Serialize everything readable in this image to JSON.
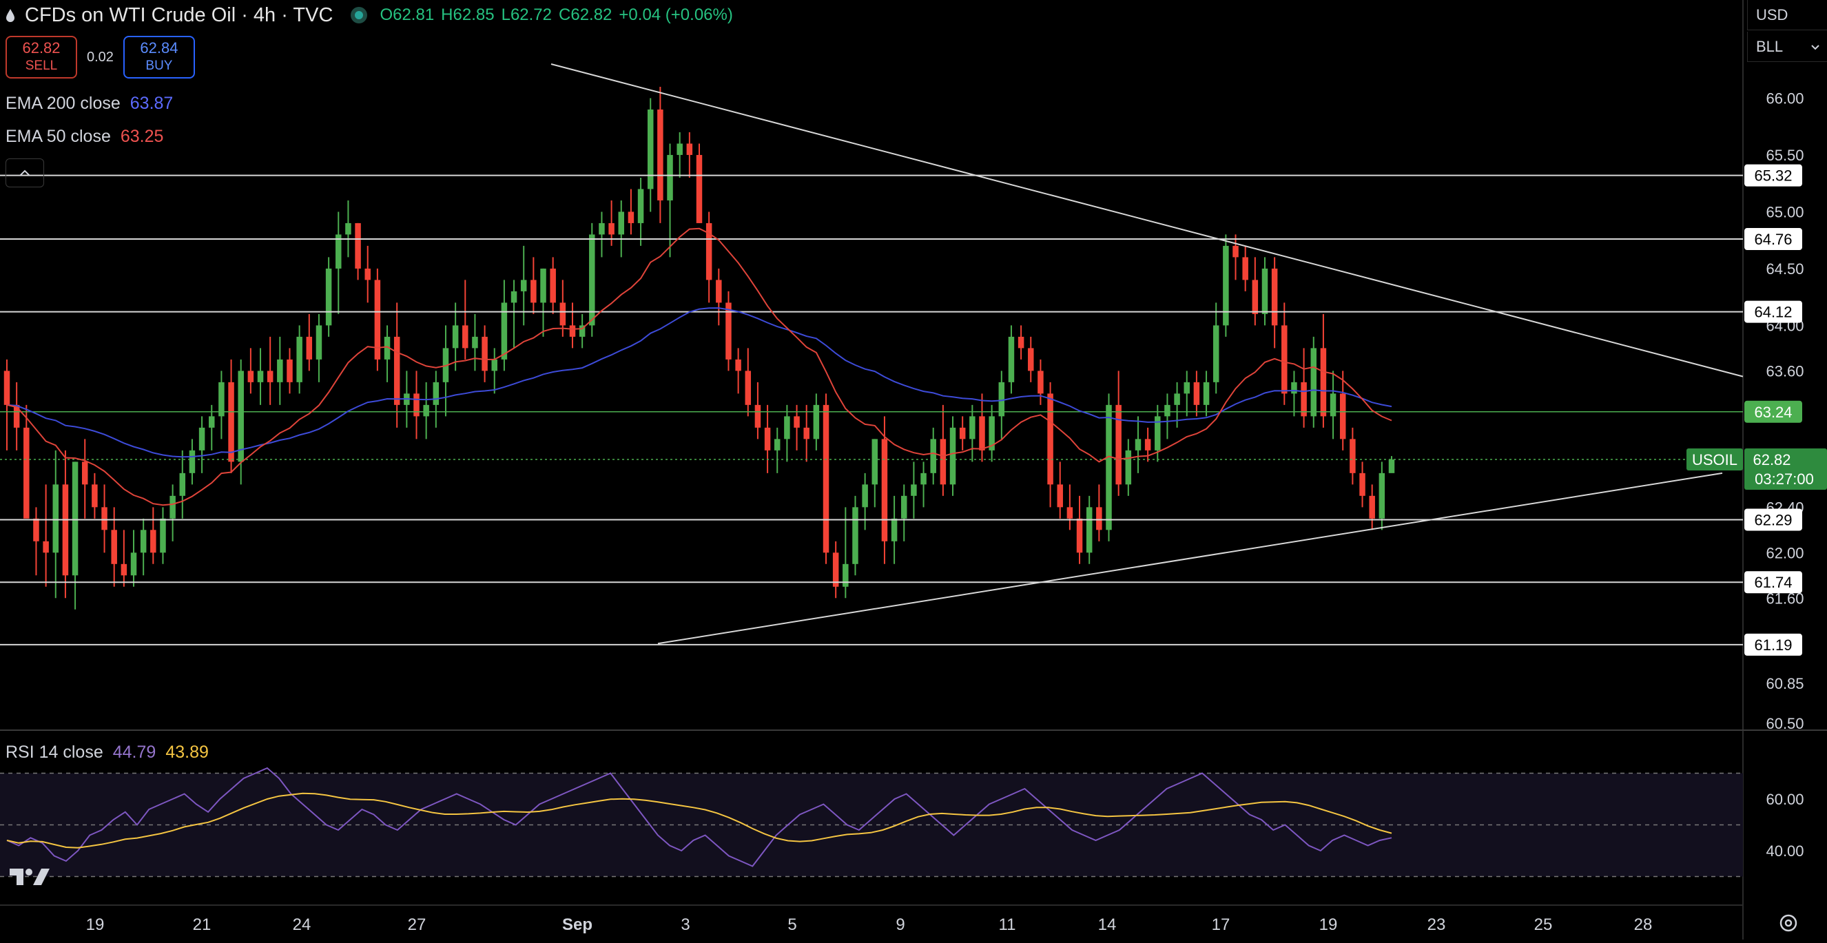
{
  "header": {
    "title": "CFDs on WTI Crude Oil · 4h · TVC",
    "ohlc": {
      "o_label": "O",
      "o": "62.81",
      "h_label": "H",
      "h": "62.85",
      "l_label": "L",
      "l": "62.72",
      "c_label": "C",
      "c": "62.82",
      "change": "+0.04 (+0.06%)"
    }
  },
  "trade": {
    "sell_price": "62.82",
    "sell_label": "SELL",
    "spread": "0.02",
    "buy_price": "62.84",
    "buy_label": "BUY"
  },
  "indicators": {
    "ema200_label": "EMA 200 close",
    "ema200_value": "63.87",
    "ema50_label": "EMA 50 close",
    "ema50_value": "63.25",
    "rsi_label": "RSI 14 close",
    "rsi_value": "44.79",
    "rsi_ma_value": "43.89"
  },
  "selectors": {
    "currency": "USD",
    "unit": "BLL"
  },
  "symbol": {
    "tag": "USOIL",
    "price": "62.82",
    "countdown": "03:27:00"
  },
  "colors": {
    "bg": "#000000",
    "up": "#4caf50",
    "down": "#f44336",
    "ema200": "#3d4bd8",
    "ema50": "#e0443a",
    "rsi": "#7e57c2",
    "rsi_ma": "#f5c542",
    "green_level": "#4caf50",
    "line": "#d8d8d8"
  },
  "chart_data": {
    "type": "candlestick",
    "timeframe": "4h",
    "x_tick_labels": [
      "19",
      "21",
      "24",
      "27",
      "Sep",
      "3",
      "5",
      "9",
      "11",
      "14",
      "17",
      "19",
      "23",
      "25",
      "28"
    ],
    "y_tick_labels": [
      "66.00",
      "65.50",
      "65.00",
      "64.50",
      "64.00",
      "63.60",
      "62.40",
      "62.00",
      "61.60",
      "60.85",
      "60.50"
    ],
    "y_range": [
      60.45,
      66.5
    ],
    "horizontal_levels": [
      "65.32",
      "64.76",
      "64.12",
      "63.24",
      "62.29",
      "61.74",
      "61.19"
    ],
    "green_level": "63.24",
    "current_price": "62.82",
    "trendlines": [
      {
        "name": "descending-resistance",
        "from": {
          "x": "Aug 29",
          "y": 66.3
        },
        "to": {
          "x": "Sep 23",
          "y": 63.55
        }
      },
      {
        "name": "ascending-support",
        "from": {
          "x": "Aug 30",
          "y": 61.2
        },
        "to": {
          "x": "Sep 22",
          "y": 62.7
        }
      }
    ],
    "ohlc_series": [
      [
        63.6,
        63.7,
        62.9,
        63.3
      ],
      [
        63.3,
        63.5,
        62.9,
        63.1
      ],
      [
        63.1,
        63.3,
        62.5,
        62.3
      ],
      [
        62.3,
        62.4,
        61.8,
        62.1
      ],
      [
        62.1,
        62.6,
        61.7,
        62.0
      ],
      [
        62.0,
        62.9,
        61.6,
        62.6
      ],
      [
        62.6,
        62.9,
        61.6,
        61.8
      ],
      [
        61.8,
        62.8,
        61.5,
        62.8
      ],
      [
        62.8,
        63.0,
        62.3,
        62.6
      ],
      [
        62.6,
        62.7,
        62.3,
        62.4
      ],
      [
        62.4,
        62.6,
        62.0,
        62.2
      ],
      [
        62.2,
        62.4,
        61.7,
        61.9
      ],
      [
        61.9,
        62.2,
        61.7,
        61.8
      ],
      [
        61.8,
        62.2,
        61.7,
        62.0
      ],
      [
        62.0,
        62.3,
        61.8,
        62.2
      ],
      [
        62.2,
        62.4,
        61.9,
        62.0
      ],
      [
        62.0,
        62.4,
        61.9,
        62.3
      ],
      [
        62.3,
        62.6,
        62.1,
        62.5
      ],
      [
        62.5,
        62.9,
        62.3,
        62.7
      ],
      [
        62.7,
        63.0,
        62.6,
        62.9
      ],
      [
        62.9,
        63.2,
        62.7,
        63.1
      ],
      [
        63.1,
        63.3,
        62.9,
        63.2
      ],
      [
        63.2,
        63.6,
        63.0,
        63.5
      ],
      [
        63.5,
        63.7,
        62.7,
        62.8
      ],
      [
        62.8,
        63.7,
        62.6,
        63.6
      ],
      [
        63.6,
        63.8,
        63.4,
        63.5
      ],
      [
        63.5,
        63.8,
        63.3,
        63.6
      ],
      [
        63.6,
        63.9,
        63.3,
        63.5
      ],
      [
        63.5,
        63.9,
        63.3,
        63.7
      ],
      [
        63.7,
        63.8,
        63.4,
        63.5
      ],
      [
        63.5,
        64.0,
        63.4,
        63.9
      ],
      [
        63.9,
        64.1,
        63.6,
        63.7
      ],
      [
        63.7,
        64.1,
        63.5,
        64.0
      ],
      [
        64.0,
        64.6,
        63.9,
        64.5
      ],
      [
        64.5,
        65.0,
        64.1,
        64.8
      ],
      [
        64.8,
        65.1,
        64.6,
        64.9
      ],
      [
        64.9,
        64.9,
        64.4,
        64.5
      ],
      [
        64.5,
        64.7,
        64.2,
        64.4
      ],
      [
        64.4,
        64.5,
        63.6,
        63.7
      ],
      [
        63.7,
        64.0,
        63.5,
        63.9
      ],
      [
        63.9,
        64.2,
        63.1,
        63.3
      ],
      [
        63.3,
        63.6,
        63.1,
        63.4
      ],
      [
        63.4,
        63.6,
        63.0,
        63.2
      ],
      [
        63.2,
        63.5,
        63.0,
        63.3
      ],
      [
        63.3,
        63.6,
        63.1,
        63.5
      ],
      [
        63.5,
        64.0,
        63.2,
        63.8
      ],
      [
        63.8,
        64.2,
        63.6,
        64.0
      ],
      [
        64.0,
        64.4,
        63.7,
        63.8
      ],
      [
        63.8,
        64.1,
        63.6,
        63.9
      ],
      [
        63.9,
        64.0,
        63.5,
        63.6
      ],
      [
        63.6,
        63.8,
        63.4,
        63.7
      ],
      [
        63.7,
        64.4,
        63.6,
        64.2
      ],
      [
        64.2,
        64.4,
        63.8,
        64.3
      ],
      [
        64.3,
        64.7,
        64.0,
        64.4
      ],
      [
        64.4,
        64.6,
        64.1,
        64.2
      ],
      [
        64.2,
        64.5,
        63.9,
        64.5
      ],
      [
        64.5,
        64.6,
        64.1,
        64.2
      ],
      [
        64.2,
        64.4,
        63.9,
        64.0
      ],
      [
        64.0,
        64.2,
        63.8,
        63.9
      ],
      [
        63.9,
        64.1,
        63.8,
        64.0
      ],
      [
        64.0,
        64.9,
        63.9,
        64.8
      ],
      [
        64.8,
        65.0,
        64.6,
        64.9
      ],
      [
        64.9,
        65.1,
        64.7,
        64.8
      ],
      [
        64.8,
        65.1,
        64.6,
        65.0
      ],
      [
        65.0,
        65.2,
        64.8,
        64.9
      ],
      [
        64.9,
        65.3,
        64.7,
        65.2
      ],
      [
        65.2,
        66.0,
        65.0,
        65.9
      ],
      [
        65.9,
        66.1,
        64.9,
        65.1
      ],
      [
        65.1,
        65.6,
        64.6,
        65.5
      ],
      [
        65.5,
        65.7,
        65.3,
        65.6
      ],
      [
        65.6,
        65.7,
        65.3,
        65.5
      ],
      [
        65.5,
        65.6,
        64.9,
        64.9
      ],
      [
        64.9,
        65.0,
        64.2,
        64.4
      ],
      [
        64.4,
        64.5,
        64.0,
        64.2
      ],
      [
        64.2,
        64.3,
        63.6,
        63.7
      ],
      [
        63.7,
        63.8,
        63.4,
        63.6
      ],
      [
        63.6,
        63.8,
        63.2,
        63.3
      ],
      [
        63.3,
        63.5,
        63.0,
        63.1
      ],
      [
        63.1,
        63.3,
        62.7,
        62.9
      ],
      [
        62.9,
        63.1,
        62.7,
        63.0
      ],
      [
        63.0,
        63.3,
        62.8,
        63.2
      ],
      [
        63.2,
        63.3,
        62.9,
        63.1
      ],
      [
        63.1,
        63.3,
        62.8,
        63.0
      ],
      [
        63.0,
        63.4,
        62.9,
        63.3
      ],
      [
        63.3,
        63.4,
        61.9,
        62.0
      ],
      [
        62.0,
        62.1,
        61.6,
        61.7
      ],
      [
        61.7,
        62.4,
        61.6,
        61.9
      ],
      [
        61.9,
        62.5,
        61.8,
        62.4
      ],
      [
        62.4,
        62.7,
        62.2,
        62.6
      ],
      [
        62.6,
        63.0,
        62.4,
        63.0
      ],
      [
        63.0,
        63.2,
        61.9,
        62.1
      ],
      [
        62.1,
        62.5,
        61.9,
        62.3
      ],
      [
        62.3,
        62.6,
        62.1,
        62.5
      ],
      [
        62.5,
        62.8,
        62.3,
        62.6
      ],
      [
        62.6,
        62.8,
        62.4,
        62.7
      ],
      [
        62.7,
        63.1,
        62.6,
        63.0
      ],
      [
        63.0,
        63.3,
        62.5,
        62.6
      ],
      [
        62.6,
        63.2,
        62.5,
        63.1
      ],
      [
        63.1,
        63.2,
        62.9,
        63.0
      ],
      [
        63.0,
        63.3,
        62.8,
        63.2
      ],
      [
        63.2,
        63.4,
        62.8,
        62.9
      ],
      [
        62.9,
        63.3,
        62.8,
        63.2
      ],
      [
        63.2,
        63.6,
        63.0,
        63.5
      ],
      [
        63.5,
        64.0,
        63.4,
        63.9
      ],
      [
        63.9,
        64.0,
        63.7,
        63.8
      ],
      [
        63.8,
        63.9,
        63.5,
        63.6
      ],
      [
        63.6,
        63.7,
        63.3,
        63.4
      ],
      [
        63.4,
        63.5,
        62.4,
        62.6
      ],
      [
        62.6,
        62.8,
        62.3,
        62.4
      ],
      [
        62.4,
        62.6,
        62.2,
        62.3
      ],
      [
        62.3,
        62.5,
        61.9,
        62.0
      ],
      [
        62.0,
        62.5,
        61.9,
        62.4
      ],
      [
        62.4,
        62.6,
        62.1,
        62.2
      ],
      [
        62.2,
        63.4,
        62.1,
        63.3
      ],
      [
        63.3,
        63.6,
        62.5,
        62.6
      ],
      [
        62.6,
        63.0,
        62.5,
        62.9
      ],
      [
        62.9,
        63.2,
        62.7,
        63.0
      ],
      [
        63.0,
        63.1,
        62.8,
        62.9
      ],
      [
        62.9,
        63.3,
        62.8,
        63.2
      ],
      [
        63.2,
        63.4,
        63.0,
        63.3
      ],
      [
        63.3,
        63.5,
        63.1,
        63.4
      ],
      [
        63.4,
        63.6,
        63.2,
        63.5
      ],
      [
        63.5,
        63.6,
        63.2,
        63.3
      ],
      [
        63.3,
        63.6,
        63.2,
        63.5
      ],
      [
        63.5,
        64.2,
        63.4,
        64.0
      ],
      [
        64.0,
        64.8,
        63.9,
        64.7
      ],
      [
        64.7,
        64.8,
        64.4,
        64.6
      ],
      [
        64.6,
        64.7,
        64.3,
        64.4
      ],
      [
        64.4,
        64.6,
        64.0,
        64.1
      ],
      [
        64.1,
        64.6,
        64.0,
        64.5
      ],
      [
        64.5,
        64.6,
        63.8,
        64.0
      ],
      [
        64.0,
        64.2,
        63.3,
        63.4
      ],
      [
        63.4,
        63.6,
        63.2,
        63.5
      ],
      [
        63.5,
        63.8,
        63.1,
        63.2
      ],
      [
        63.2,
        63.9,
        63.1,
        63.8
      ],
      [
        63.8,
        64.1,
        63.1,
        63.2
      ],
      [
        63.2,
        63.6,
        63.0,
        63.4
      ],
      [
        63.4,
        63.6,
        62.9,
        63.0
      ],
      [
        63.0,
        63.1,
        62.6,
        62.7
      ],
      [
        62.7,
        62.8,
        62.4,
        62.5
      ],
      [
        62.5,
        62.6,
        62.2,
        62.3
      ],
      [
        62.3,
        62.8,
        62.2,
        62.7
      ],
      [
        62.7,
        62.85,
        62.72,
        62.82
      ]
    ],
    "ema200": "63.87",
    "ema50": "63.25",
    "rsi": {
      "label": "RSI 14 close",
      "value": "44.79",
      "ma_value": "43.89",
      "y_range": [
        20,
        80
      ],
      "y_tick_labels": [
        "60.00",
        "40.00"
      ],
      "bands": [
        70,
        50,
        30
      ],
      "series": [
        44,
        42,
        45,
        43,
        38,
        36,
        40,
        46,
        48,
        52,
        55,
        50,
        56,
        58,
        60,
        62,
        58,
        55,
        60,
        64,
        68,
        70,
        72,
        68,
        62,
        58,
        54,
        50,
        48,
        52,
        56,
        54,
        50,
        48,
        52,
        56,
        58,
        60,
        62,
        60,
        58,
        55,
        52,
        50,
        54,
        58,
        60,
        62,
        64,
        66,
        68,
        70,
        64,
        58,
        52,
        46,
        42,
        40,
        44,
        46,
        42,
        38,
        36,
        34,
        40,
        46,
        50,
        54,
        56,
        58,
        54,
        50,
        48,
        52,
        56,
        60,
        62,
        58,
        54,
        50,
        46,
        50,
        54,
        58,
        60,
        62,
        64,
        60,
        56,
        52,
        48,
        46,
        44,
        46,
        48,
        52,
        56,
        60,
        64,
        66,
        68,
        70,
        66,
        62,
        58,
        54,
        52,
        48,
        50,
        46,
        42,
        40,
        44,
        46,
        44,
        42,
        44,
        45
      ]
    }
  }
}
